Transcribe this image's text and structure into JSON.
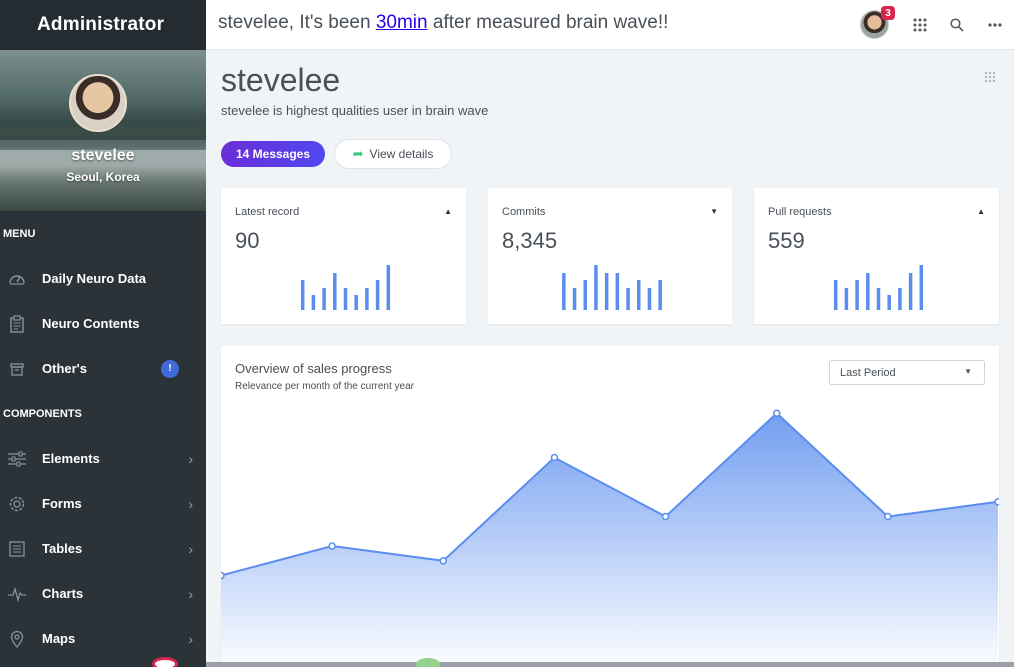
{
  "sidebar": {
    "brand": "Administrator",
    "profile": {
      "name": "stevelee",
      "location": "Seoul, Korea"
    },
    "menu_heading": "MENU",
    "menu_items": [
      {
        "label": "Daily Neuro Data",
        "icon": "gauge-icon"
      },
      {
        "label": "Neuro Contents",
        "icon": "clipboard-icon"
      },
      {
        "label": "Other's",
        "icon": "archive-icon",
        "badge": "!"
      }
    ],
    "components_heading": "COMPONENTS",
    "component_items": [
      {
        "label": "Elements",
        "icon": "sliders-icon"
      },
      {
        "label": "Forms",
        "icon": "gear-icon"
      },
      {
        "label": "Tables",
        "icon": "table-icon"
      },
      {
        "label": "Charts",
        "icon": "pulse-icon"
      },
      {
        "label": "Maps",
        "icon": "map-pin-icon"
      }
    ]
  },
  "topbar": {
    "message_prefix": "stevelee, It's been ",
    "message_link": "30min",
    "message_suffix": " after measured brain wave!!",
    "notification_count": "3"
  },
  "header": {
    "title": "stevelee",
    "subtitle": "stevelee is highest qualities user in brain wave",
    "messages_button": "14 Messages",
    "view_details_button": "View details"
  },
  "stats": [
    {
      "label": "Latest record",
      "value": "90",
      "trend": "up",
      "bars": [
        30,
        15,
        22,
        37,
        22,
        15,
        22,
        30,
        45
      ]
    },
    {
      "label": "Commits",
      "value": "8,345",
      "trend": "down",
      "bars": [
        37,
        22,
        30,
        45,
        37,
        37,
        22,
        30,
        22,
        30
      ]
    },
    {
      "label": "Pull requests",
      "value": "559",
      "trend": "up",
      "bars": [
        30,
        22,
        30,
        37,
        22,
        15,
        22,
        37,
        45
      ]
    }
  ],
  "overview": {
    "title": "Overview of sales progress",
    "subtitle": "Relevance per month of the current year",
    "period_select": "Last Period"
  },
  "chart_data": {
    "type": "area",
    "x": [
      1,
      2,
      3,
      4,
      5,
      6,
      7,
      8
    ],
    "values": [
      31,
      41,
      36,
      71,
      51,
      86,
      51,
      56
    ],
    "ylim": [
      0,
      100
    ],
    "grid": false,
    "color": "#5a8dee"
  },
  "colors": {
    "sidebar_bg": "#2b3339",
    "accent": "#3f6ad8",
    "bar_blue": "#5a8dee",
    "badge_red": "#d92550",
    "success_green": "#3ac47d"
  }
}
